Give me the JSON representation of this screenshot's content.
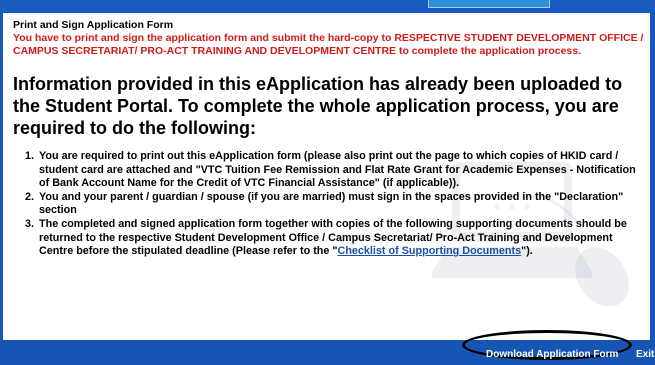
{
  "form": {
    "title": "Print and Sign Application Form",
    "notice": "You have to print and sign the application form and submit the hard-copy to RESPECTIVE STUDENT DEVELOPMENT OFFICE / CAMPUS SECRETARIAT/ PRO-ACT TRAINING AND DEVELOPMENT CENTRE to complete the application process."
  },
  "main": {
    "headline": "Information provided in this eApplication has already been uploaded to the Student Portal. To complete the whole application process, you are required to do the following:",
    "steps": [
      "You are required to print out this eApplication form (please also print out the page to which copies of HKID card / student card are attached and \"VTC Tuition Fee Remission and Flat Rate Grant for Academic Expenses - Notification of Bank Account Name for the Credit of VTC Financial Assistance\" (if applicable)).",
      "You and your parent / guardian / spouse (if you are married) must sign in the spaces provided in the \"Declaration\" section",
      "The completed and signed application form together with copies of the following supporting documents should be returned to the respective Student Development Office / Campus Secretariat/ Pro-Act Training and Development Centre before the stipulated deadline (Please refer to the \""
    ],
    "step3_link": "Checklist of Supporting Documents",
    "step3_suffix": "\")."
  },
  "footer": {
    "download_label": "Download Application Form",
    "exit_label": "Exit"
  },
  "colors": {
    "background": "#1858b8",
    "notice_red": "#d11a1a",
    "link_blue": "#1a4fa8"
  },
  "icons": [
    "computer-illustration-icon",
    "mouse-icon"
  ]
}
